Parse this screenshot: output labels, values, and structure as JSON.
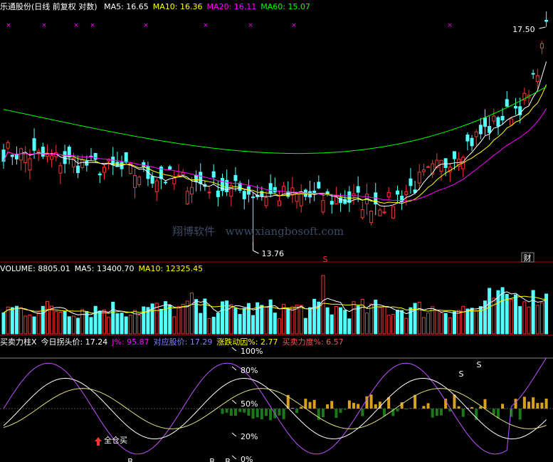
{
  "chart_data": {
    "type": "candlestick",
    "price_panel": {
      "title": "乐通股份(日线 前复权 对数)",
      "indicators": [
        {
          "label": "MA5: 16.65",
          "color": "#ffffff"
        },
        {
          "label": "MA10: 16.36",
          "color": "#ffff00"
        },
        {
          "label": "MA20: 16.11",
          "color": "#ff00ff"
        },
        {
          "label": "MA60: 15.07",
          "color": "#00ff00"
        }
      ],
      "high_label": "17.50",
      "low_label": "13.76",
      "scale": "log",
      "markers": [
        {
          "text": "S",
          "color": "#ff3333"
        },
        {
          "text": "财",
          "color": "#ffffff"
        }
      ],
      "last_close": 17.5
    },
    "volume_panel": {
      "indicators": [
        {
          "label": "VOLUME: 8805.01",
          "color": "#ffffff"
        },
        {
          "label": "MA5: 13400.70",
          "color": "#ffffff"
        },
        {
          "label": "MA10: 12325.45",
          "color": "#ffff00"
        }
      ],
      "last_volume": 8805.01
    },
    "indicator_panel": {
      "indicators": [
        {
          "label": "买卖力柱X",
          "color": "#ffffff"
        },
        {
          "label": "今日拐头价: 17.24",
          "color": "#ffffff"
        },
        {
          "label": "J%: 95.87",
          "color": "#ff00ff"
        },
        {
          "label": "对应股价: 17.29",
          "color": "#8080ff"
        },
        {
          "label": "涨跌动因%: 2.77",
          "color": "#ffff00"
        },
        {
          "label": "买卖力度%: 6.57",
          "color": "#ff5050"
        }
      ],
      "levels": [
        "100%",
        "80%",
        "50%",
        "20%",
        "0%"
      ],
      "signal_text": "全仓买",
      "signal_marks": [
        "B",
        "B",
        "B",
        "S",
        "S"
      ]
    }
  },
  "watermark": [
    "翔博软件",
    "www.xiangbosoft.com"
  ]
}
